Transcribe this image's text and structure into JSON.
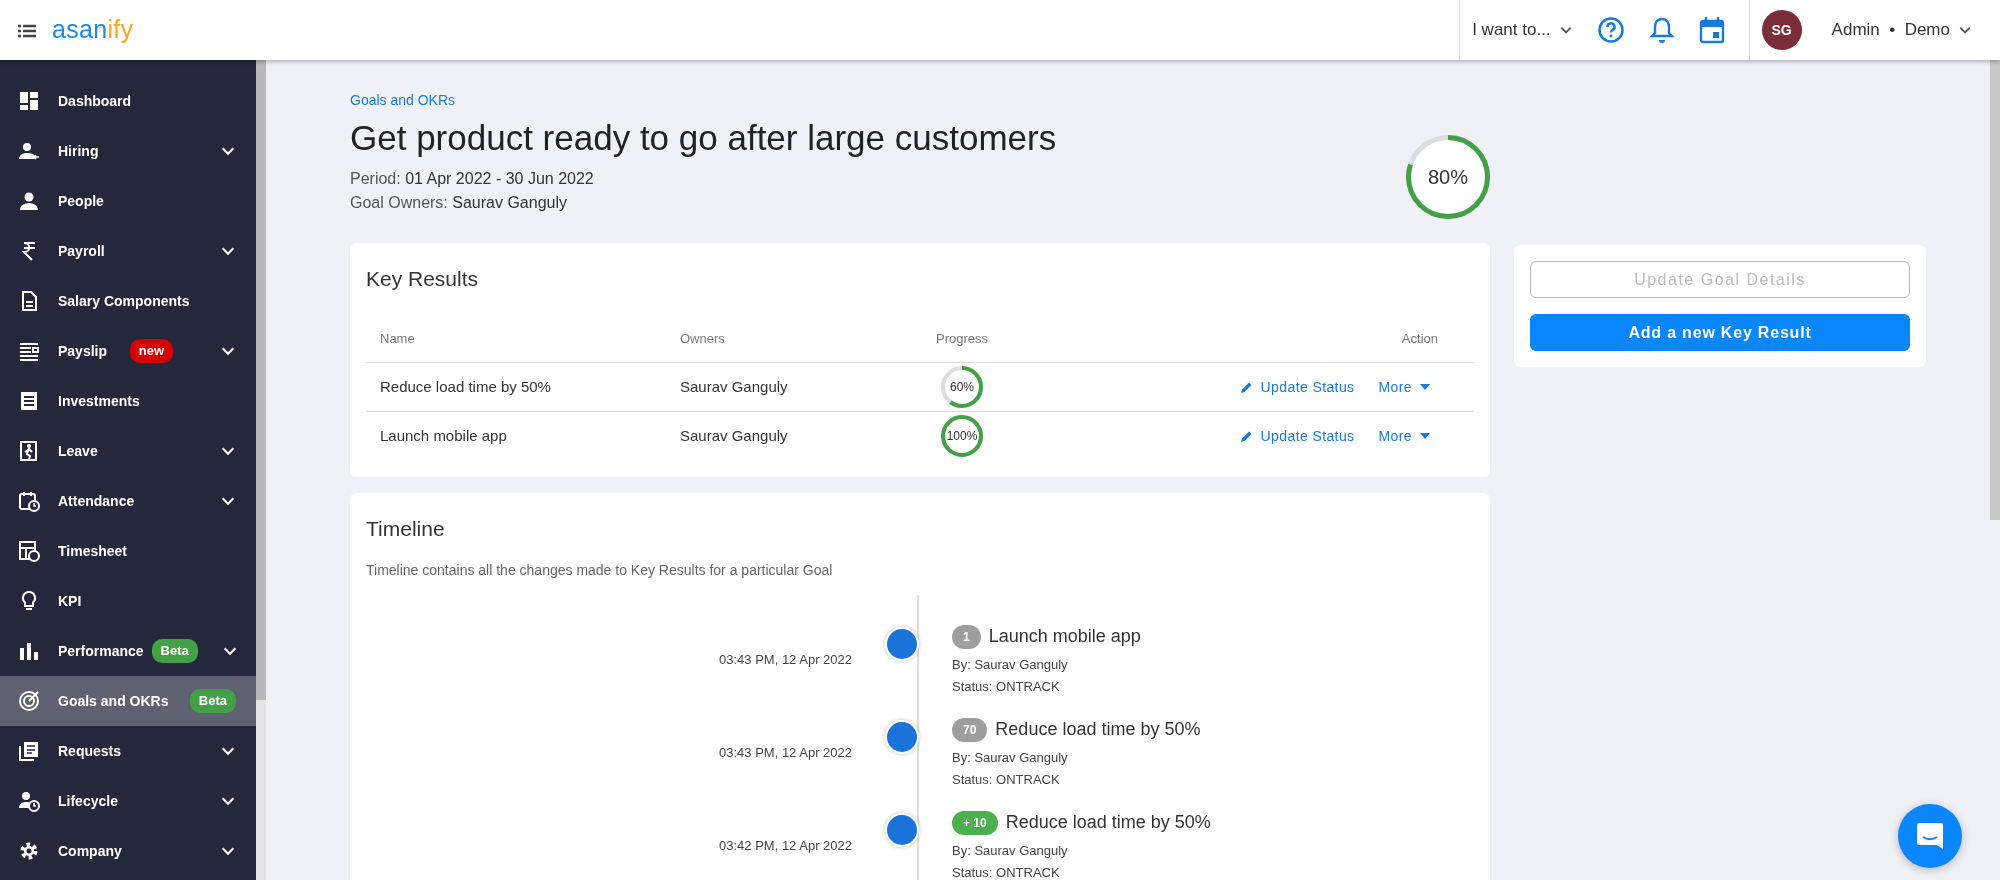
{
  "topbar": {
    "logo": {
      "main": "asan",
      "accent": "ify"
    },
    "quick_menu": "I want to...",
    "avatar": "SG",
    "user": "Admin",
    "org": "Demo",
    "separator": "•"
  },
  "sidebar": {
    "items": [
      {
        "label": "Dashboard",
        "expandable": false,
        "selected": false
      },
      {
        "label": "Hiring",
        "expandable": true,
        "selected": false
      },
      {
        "label": "People",
        "expandable": false,
        "selected": false
      },
      {
        "label": "Payroll",
        "expandable": true,
        "selected": false
      },
      {
        "label": "Salary Components",
        "expandable": false,
        "selected": false
      },
      {
        "label": "Payslip",
        "expandable": true,
        "selected": false,
        "badge": {
          "text": "new",
          "color": "#d50000"
        }
      },
      {
        "label": "Investments",
        "expandable": false,
        "selected": false
      },
      {
        "label": "Leave",
        "expandable": true,
        "selected": false
      },
      {
        "label": "Attendance",
        "expandable": true,
        "selected": false
      },
      {
        "label": "Timesheet",
        "expandable": false,
        "selected": false
      },
      {
        "label": "KPI",
        "expandable": false,
        "selected": false
      },
      {
        "label": "Performance",
        "expandable": true,
        "selected": false,
        "badge": {
          "text": "Beta",
          "color": "#43a047"
        }
      },
      {
        "label": "Goals and OKRs",
        "expandable": false,
        "selected": true,
        "badge": {
          "text": "Beta",
          "color": "#43a047"
        }
      },
      {
        "label": "Requests",
        "expandable": true,
        "selected": false
      },
      {
        "label": "Lifecycle",
        "expandable": true,
        "selected": false
      },
      {
        "label": "Company",
        "expandable": true,
        "selected": false
      }
    ]
  },
  "goal": {
    "breadcrumb": "Goals and OKRs",
    "title": "Get product ready to go after large customers",
    "period_label": "Period:",
    "period": "01 Apr 2022 - 30 Jun 2022",
    "owners_label": "Goal Owners:",
    "owners": "Saurav Ganguly",
    "level": 0.8,
    "reading": "80%"
  },
  "key_results": {
    "title": "Key Results",
    "columns": [
      "Name",
      "Owners",
      "Progress",
      "Action"
    ],
    "rows": [
      {
        "name": "Reduce load time by 50%",
        "owner": "Saurav Ganguly",
        "level": 0.6,
        "reading": "60%",
        "update": "Update Status",
        "more": "More"
      },
      {
        "name": "Launch mobile app",
        "owner": "Saurav Ganguly",
        "level": 1,
        "reading": "100%",
        "update": "Update Status",
        "more": "More"
      }
    ]
  },
  "side_panel": {
    "buttons": [
      {
        "label": "Update Goal Details",
        "disabled": true
      },
      {
        "label": "Add a new Key Result",
        "disabled": false
      }
    ]
  },
  "timeline": {
    "title": "Timeline",
    "description": "Timeline contains all the changes made to Key Results for a particular Goal",
    "items": [
      {
        "time": "03:43 PM, 12 Apr 2022",
        "badge": "1",
        "color": "#9e9e9e",
        "title": "Launch mobile app",
        "by": "By: Saurav Ganguly",
        "status": "Status: ONTRACK"
      },
      {
        "time": "03:43 PM, 12 Apr 2022",
        "badge": "70",
        "color": "#9e9e9e",
        "title": "Reduce load time by 50%",
        "by": "By: Saurav Ganguly",
        "status": "Status: ONTRACK"
      },
      {
        "time": "03:42 PM, 12 Apr 2022",
        "badge": "+ 10",
        "color": "#4caf50",
        "title": "Reduce load time by 50%",
        "by": "By: Saurav Ganguly",
        "status": "Status: ONTRACK"
      }
    ]
  }
}
